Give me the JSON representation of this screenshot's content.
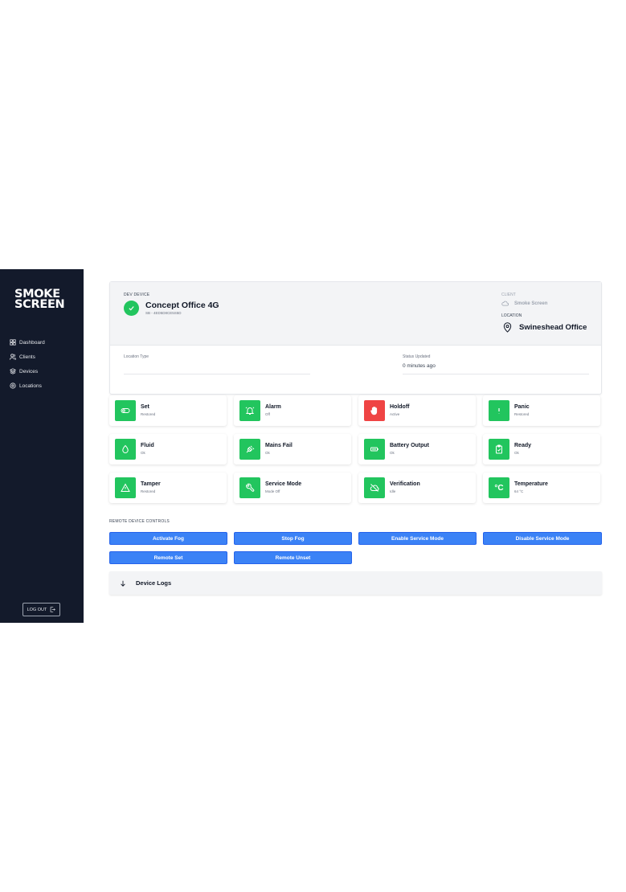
{
  "sidebar": {
    "logo_line1": "SMOKE",
    "logo_line2": "SCREEN",
    "items": [
      {
        "label": "Dashboard",
        "icon": "grid-icon"
      },
      {
        "label": "Clients",
        "icon": "users-icon"
      },
      {
        "label": "Devices",
        "icon": "layers-icon"
      },
      {
        "label": "Locations",
        "icon": "pin-icon"
      }
    ],
    "logout_label": "LOG OUT"
  },
  "device": {
    "section_label": "DEV DEVICE",
    "name": "Concept Office 4G",
    "id": "SB - 4ED5D8CE5S5D",
    "client_label": "CLIENT",
    "client_name": "Smoke Screen",
    "location_label": "LOCATION",
    "location_name": "Swineshead Office",
    "fields": {
      "location_type_label": "Location Type",
      "location_type_value": "",
      "status_updated_label": "Status Updated",
      "status_updated_value": "0 minutes ago"
    }
  },
  "statuses": [
    {
      "title": "Set",
      "state": "Restored",
      "color": "#22c55e",
      "icon": "toggle-icon"
    },
    {
      "title": "Alarm",
      "state": "Off",
      "color": "#22c55e",
      "icon": "bell-icon"
    },
    {
      "title": "Holdoff",
      "state": "Active",
      "color": "#ef4444",
      "icon": "hand-icon"
    },
    {
      "title": "Panic",
      "state": "Restored",
      "color": "#22c55e",
      "icon": "exclamation-icon"
    },
    {
      "title": "Fluid",
      "state": "Ok",
      "color": "#22c55e",
      "icon": "droplet-icon"
    },
    {
      "title": "Mains Fail",
      "state": "Ok",
      "color": "#22c55e",
      "icon": "plug-icon"
    },
    {
      "title": "Battery Output",
      "state": "Ok",
      "color": "#22c55e",
      "icon": "battery-icon"
    },
    {
      "title": "Ready",
      "state": "Ok",
      "color": "#22c55e",
      "icon": "clipboard-check-icon"
    },
    {
      "title": "Tamper",
      "state": "Restored",
      "color": "#22c55e",
      "icon": "warning-icon"
    },
    {
      "title": "Service Mode",
      "state": "Mode Off",
      "color": "#22c55e",
      "icon": "wrench-icon"
    },
    {
      "title": "Verification",
      "state": "Idle",
      "color": "#22c55e",
      "icon": "cloud-off-icon"
    },
    {
      "title": "Temperature",
      "state": "64 °C",
      "color": "#22c55e",
      "icon": "celsius-icon",
      "glyph": "°C"
    }
  ],
  "controls": {
    "title": "REMOTE DEVICE CONTROLS",
    "buttons": [
      "Activate Fog",
      "Stop Fog",
      "Enable Service Mode",
      "Disable Service Mode",
      "Remote Set",
      "Remote Unset"
    ]
  },
  "logs": {
    "label": "Device Logs"
  }
}
